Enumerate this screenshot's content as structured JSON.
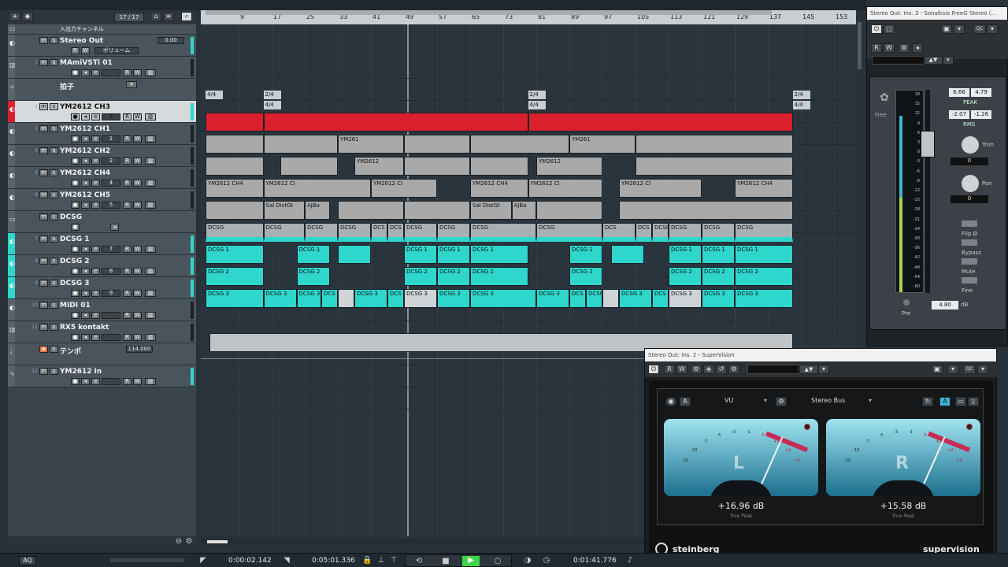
{
  "toolbar": {
    "track_count": "17 / 17",
    "add_icon": "plus-icon",
    "search_icon": "search-icon"
  },
  "ruler": {
    "ticks": [
      "9",
      "17",
      "25",
      "33",
      "41",
      "49",
      "57",
      "65",
      "73",
      "81",
      "89",
      "97",
      "105",
      "113",
      "121",
      "129",
      "137",
      "145",
      "153"
    ]
  },
  "tracks": [
    {
      "num": "",
      "name": "入出力チャンネル",
      "color": "#5a636a",
      "type": "folder",
      "sub": ""
    },
    {
      "num": "",
      "name": "Stereo Out",
      "color": "#5a636a",
      "type": "output",
      "sub": "0.00",
      "volume_label": "ボリューム"
    },
    {
      "num": "1",
      "name": "MAmiVSTi 01",
      "color": "#5a636a",
      "type": "instrument",
      "sub": ""
    },
    {
      "num": "",
      "name": "拍子",
      "color": "#5a636a",
      "type": "signature",
      "sub": ""
    },
    {
      "num": "2",
      "name": "YM2612 CH3",
      "color": "#d9202c",
      "type": "midi",
      "sub": "3",
      "selected": true
    },
    {
      "num": "3",
      "name": "YM2612 CH1",
      "color": "#5a636a",
      "type": "midi",
      "sub": "1"
    },
    {
      "num": "4",
      "name": "YM2612 CH2",
      "color": "#5a636a",
      "type": "midi",
      "sub": "2"
    },
    {
      "num": "5",
      "name": "YM2612 CH4",
      "color": "#5a636a",
      "type": "midi",
      "sub": "4"
    },
    {
      "num": "6",
      "name": "YM2612 CH5",
      "color": "#5a636a",
      "type": "midi",
      "sub": "5"
    },
    {
      "num": "",
      "name": "DCSG",
      "color": "#5a636a",
      "type": "folder",
      "sub": ""
    },
    {
      "num": "7",
      "name": "DCSG 1",
      "color": "#2ed6cc",
      "type": "midi",
      "sub": "7"
    },
    {
      "num": "8",
      "name": "DCSG 2",
      "color": "#2ed6cc",
      "type": "midi",
      "sub": "8"
    },
    {
      "num": "9",
      "name": "DCSG 3",
      "color": "#2ed6cc",
      "type": "midi",
      "sub": "9"
    },
    {
      "num": "10",
      "name": "MIDI 01",
      "color": "#5a636a",
      "type": "midi",
      "sub": ""
    },
    {
      "num": "11",
      "name": "RX5 kontakt",
      "color": "#5a636a",
      "type": "instrument",
      "sub": ""
    },
    {
      "num": "",
      "name": "テンポ",
      "color": "#5a636a",
      "type": "tempo",
      "sub": "114.000"
    },
    {
      "num": "12",
      "name": "YM2612 in",
      "color": "#5a636a",
      "type": "audio",
      "sub": ""
    }
  ],
  "signatures": [
    "4/4",
    "2/4",
    "4/4",
    "2/4",
    "4/4",
    "2/4",
    "4/4"
  ],
  "part_labels": {
    "ch1": "YM261",
    "ch2": "YM2612",
    "ch4": "YM2612 CH4",
    "ch4b": "YM2612 Cl",
    "ch5a": "Sal DistGt",
    "ch5b": "AJBa",
    "dcsg": "DCSG",
    "dcsg_short": "DCS",
    "dcsg1": "DCSG 1",
    "dcsg2": "DCSG 2",
    "dcsg3": "DCSG 3",
    "dcsg3b": "DCSG 3"
  },
  "sonalksis": {
    "title": "Stereo Out: Ins. 3 - Sonalksis FreeG Stereo (...",
    "peak_l": "6.66",
    "peak_r": "4.79",
    "peak_label": "PEAK",
    "rms_l": "-2.07",
    "rms_r": "-1.26",
    "rms_label": "RMS",
    "trim_label": "Trim",
    "trim_val": "0",
    "pan_label": "Pan",
    "pan_val": "0",
    "flip_label": "Flip Ø",
    "bypass_label": "Bypass",
    "mute_label": "Mute",
    "fine_label": "Fine",
    "pre_label": "Pre",
    "gain_val": "4.80",
    "gain_unit": "dB",
    "brand": "Free",
    "scale": [
      "18",
      "15",
      "12",
      "9",
      "6",
      "3",
      "0",
      "-3",
      "-6",
      "-9",
      "-12",
      "-15",
      "-18",
      "-21",
      "-24",
      "-30",
      "-36",
      "-42",
      "-48",
      "-54",
      "-60"
    ]
  },
  "supervision": {
    "title": "Stereo Out: Ins. 2 - SuperVision",
    "mode": "VU",
    "bus": "Stereo Bus",
    "left_label": "L",
    "right_label": "R",
    "left_value": "+16.96 dB",
    "right_value": "+15.58 dB",
    "peak_caption": "True Peak",
    "scale": [
      "-20",
      "-10",
      "-7",
      "-5",
      "-3",
      "-1",
      "0",
      "+1",
      "+2",
      "+3"
    ],
    "brand_left": "steinberg",
    "brand_right": "supervision"
  },
  "transport": {
    "pos1": "0:00:02.142",
    "pos2": "0:05:01.336",
    "pos3": "0:01:41.776",
    "aq": "AQ"
  }
}
